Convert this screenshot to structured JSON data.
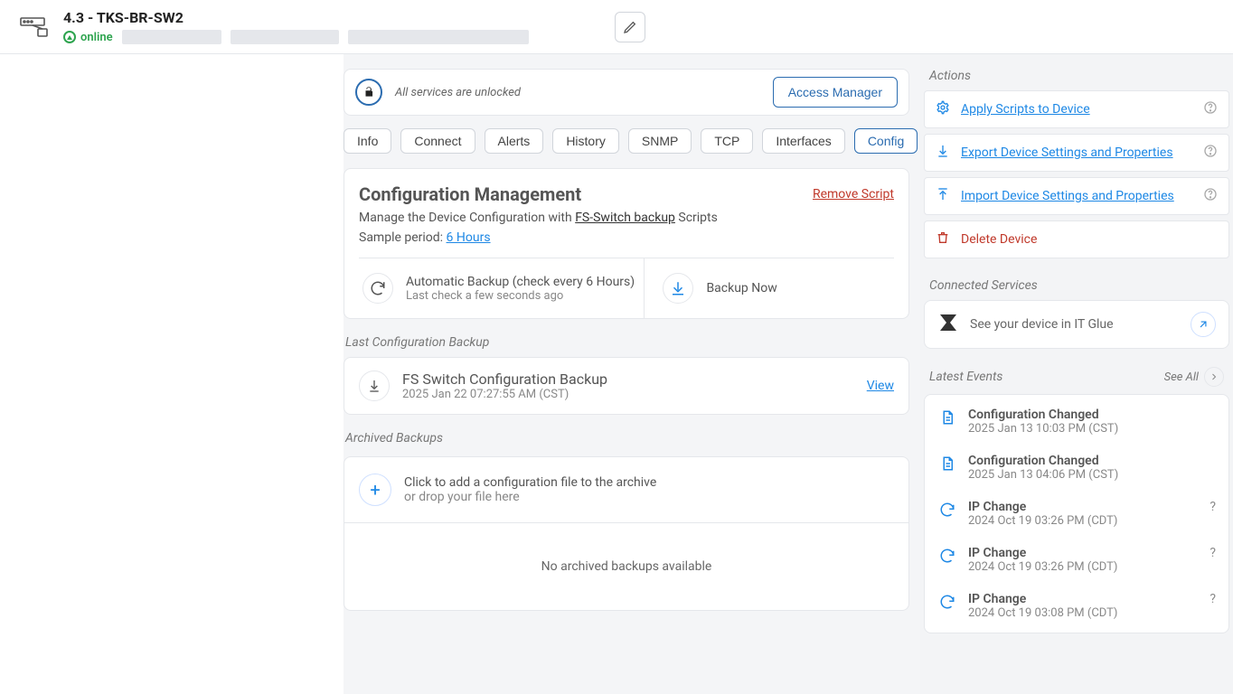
{
  "header": {
    "title": "4.3 - TKS-BR-SW2",
    "status": "online"
  },
  "unlock": {
    "text": "All services are unlocked",
    "access_btn": "Access Manager"
  },
  "tabs": [
    "Info",
    "Connect",
    "Alerts",
    "History",
    "SNMP",
    "TCP",
    "Interfaces",
    "Config"
  ],
  "active_tab": 7,
  "config": {
    "title": "Configuration Management",
    "remove": "Remove Script",
    "subtitle_prefix": "Manage the Device Configuration with ",
    "subtitle_link": "FS-Switch backup",
    "subtitle_suffix": " Scripts",
    "sample_label": "Sample period: ",
    "sample_value": "6 Hours",
    "auto_line": "Automatic Backup (check every 6 Hours)",
    "auto_sub": "Last check a few seconds ago",
    "backup_now": "Backup Now"
  },
  "last_backup": {
    "section": "Last Configuration Backup",
    "title": "FS Switch Configuration Backup",
    "time": "2025 Jan 22 07:27:55 AM (CST)",
    "view": "View"
  },
  "archived": {
    "section": "Archived Backups",
    "line1": "Click to add a configuration file to the archive",
    "line2": "or drop your file here",
    "empty": "No archived backups available"
  },
  "actions": {
    "title": "Actions",
    "items": [
      {
        "label": "Apply Scripts to Device",
        "icon": "gear"
      },
      {
        "label": "Export Device Settings and Properties",
        "icon": "download"
      },
      {
        "label": "Import Device Settings and Properties",
        "icon": "upload"
      }
    ],
    "delete": "Delete Device"
  },
  "connected": {
    "title": "Connected Services",
    "text": "See your device in IT Glue"
  },
  "events": {
    "title": "Latest Events",
    "see_all": "See All",
    "items": [
      {
        "title": "Configuration Changed",
        "time": "2025 Jan 13 10:03 PM (CST)",
        "type": "doc",
        "q": false
      },
      {
        "title": "Configuration Changed",
        "time": "2025 Jan 13 04:06 PM (CST)",
        "type": "doc",
        "q": false
      },
      {
        "title": "IP Change",
        "time": "2024 Oct 19 03:26 PM (CDT)",
        "type": "sync",
        "q": true
      },
      {
        "title": "IP Change",
        "time": "2024 Oct 19 03:26 PM (CDT)",
        "type": "sync",
        "q": true
      },
      {
        "title": "IP Change",
        "time": "2024 Oct 19 03:08 PM (CDT)",
        "type": "sync",
        "q": true
      }
    ]
  }
}
